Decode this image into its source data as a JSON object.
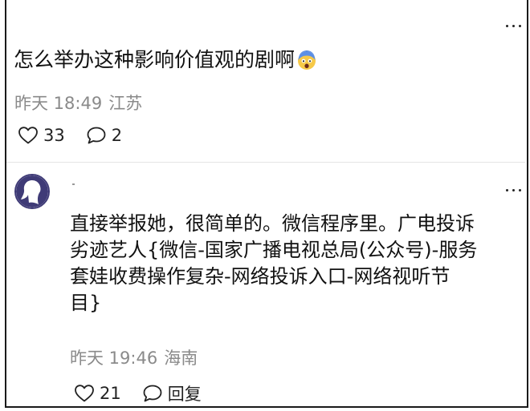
{
  "comment1": {
    "text": "怎么举办这种影响价值观的剧啊",
    "emoji": "scared-face-emoji",
    "time": "昨天 18:49",
    "location": "江苏",
    "like_count": "33",
    "reply_count": "2"
  },
  "comment2": {
    "text_lines": [
      "直接举报她，很简单的。微信程序里。广电投诉",
      "劣迹艺人{微信-国家广播电视总局(公众号)-服务",
      "套娃收费操作复杂-网络投诉入口-网络视听节",
      "目}"
    ],
    "time": "昨天 19:46",
    "location": "海南",
    "like_count": "21",
    "reply_label": "回复"
  },
  "colors": {
    "text": "#111111",
    "meta": "#8a8a8a",
    "avatar_accent": "#3f3b77"
  }
}
